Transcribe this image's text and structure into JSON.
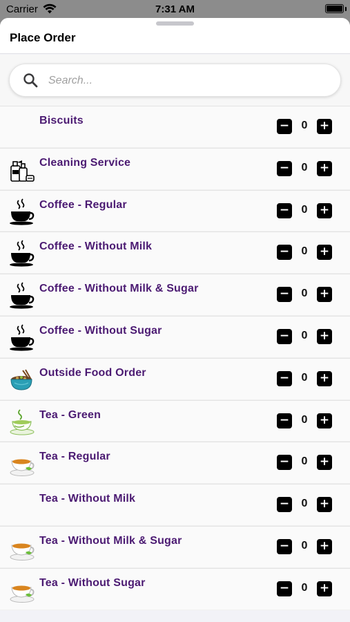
{
  "status_bar": {
    "carrier": "Carrier",
    "time": "7:31 AM"
  },
  "header": {
    "title": "Place Order"
  },
  "search": {
    "placeholder": "Search..."
  },
  "colors": {
    "item_label": "#4b1a72",
    "stepper_button": "#000000"
  },
  "items": [
    {
      "label": "Biscuits",
      "icon": "none",
      "quantity": "0",
      "minus": "−",
      "plus": "+"
    },
    {
      "label": "Cleaning Service",
      "icon": "cleaning-supplies-icon",
      "quantity": "0",
      "minus": "−",
      "plus": "+"
    },
    {
      "label": "Coffee - Regular",
      "icon": "coffee-cup-icon",
      "quantity": "0",
      "minus": "−",
      "plus": "+"
    },
    {
      "label": "Coffee - Without Milk",
      "icon": "coffee-cup-icon",
      "quantity": "0",
      "minus": "−",
      "plus": "+"
    },
    {
      "label": "Coffee - Without Milk & Sugar",
      "icon": "coffee-cup-icon",
      "quantity": "0",
      "minus": "−",
      "plus": "+"
    },
    {
      "label": "Coffee - Without Sugar",
      "icon": "coffee-cup-icon",
      "quantity": "0",
      "minus": "−",
      "plus": "+"
    },
    {
      "label": "Outside Food Order",
      "icon": "food-bowl-icon",
      "quantity": "0",
      "minus": "−",
      "plus": "+"
    },
    {
      "label": "Tea - Green",
      "icon": "green-tea-icon",
      "quantity": "0",
      "minus": "−",
      "plus": "+"
    },
    {
      "label": "Tea - Regular",
      "icon": "tea-cup-icon",
      "quantity": "0",
      "minus": "−",
      "plus": "+"
    },
    {
      "label": "Tea - Without Milk",
      "icon": "none",
      "quantity": "0",
      "minus": "−",
      "plus": "+"
    },
    {
      "label": "Tea - Without Milk & Sugar",
      "icon": "tea-cup-icon",
      "quantity": "0",
      "minus": "−",
      "plus": "+"
    },
    {
      "label": "Tea - Without Sugar",
      "icon": "tea-cup-icon",
      "quantity": "0",
      "minus": "−",
      "plus": "+"
    }
  ]
}
